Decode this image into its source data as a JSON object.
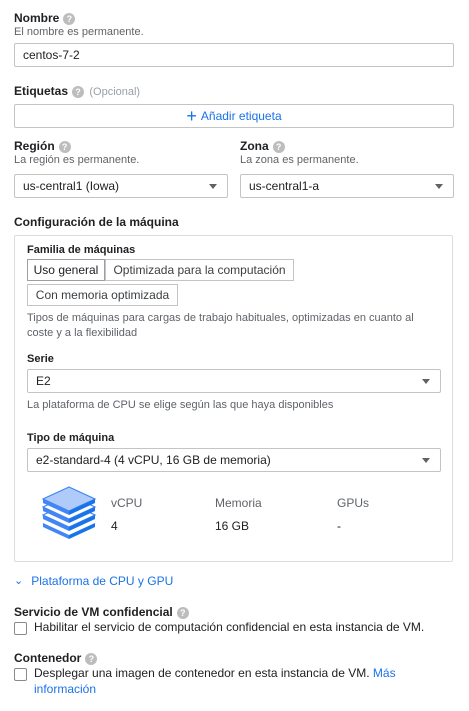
{
  "nombre": {
    "label": "Nombre",
    "hint": "El nombre es permanente.",
    "value": "centos-7-2"
  },
  "etiquetas": {
    "label": "Etiquetas",
    "optional": "(Opcional)",
    "add_button": "Añadir etiqueta"
  },
  "region": {
    "label": "Región",
    "hint": "La región es permanente.",
    "value": "us-central1 (Iowa)"
  },
  "zona": {
    "label": "Zona",
    "hint": "La zona es permanente.",
    "value": "us-central1-a"
  },
  "machine_config": {
    "heading": "Configuración de la máquina",
    "family_label": "Familia de máquinas",
    "family_tabs": [
      "Uso general",
      "Optimizada para la computación",
      "Con memoria optimizada"
    ],
    "family_description": "Tipos de máquinas para cargas de trabajo habituales, optimizadas en cuanto al coste y a la flexibilidad",
    "serie_label": "Serie",
    "serie_value": "E2",
    "serie_hint": "La plataforma de CPU se elige según las que haya disponibles",
    "machine_type_label": "Tipo de máquina",
    "machine_type_value": "e2-standard-4 (4 vCPU, 16 GB de memoria)",
    "specs": {
      "vcpu_label": "vCPU",
      "vcpu_value": "4",
      "memory_label": "Memoria",
      "memory_value": "16 GB",
      "gpu_label": "GPUs",
      "gpu_value": "-"
    }
  },
  "cpu_platform_link": "Plataforma de CPU y GPU",
  "confidential": {
    "label": "Servicio de VM confidencial",
    "checkbox_text": "Habilitar el servicio de computación confidencial en esta instancia de VM."
  },
  "container": {
    "label": "Contenedor",
    "checkbox_text": "Desplegar una imagen de contenedor en esta instancia de VM.",
    "link_more": "Más información"
  },
  "colors": {
    "accent": "#1a73e8",
    "text": "#202124",
    "muted": "#5f6368"
  },
  "icons": [
    "help-icon",
    "plus-icon",
    "dropdown-caret-icon",
    "stack-layers-icon",
    "double-chevron-down-icon",
    "checkbox-icon"
  ]
}
